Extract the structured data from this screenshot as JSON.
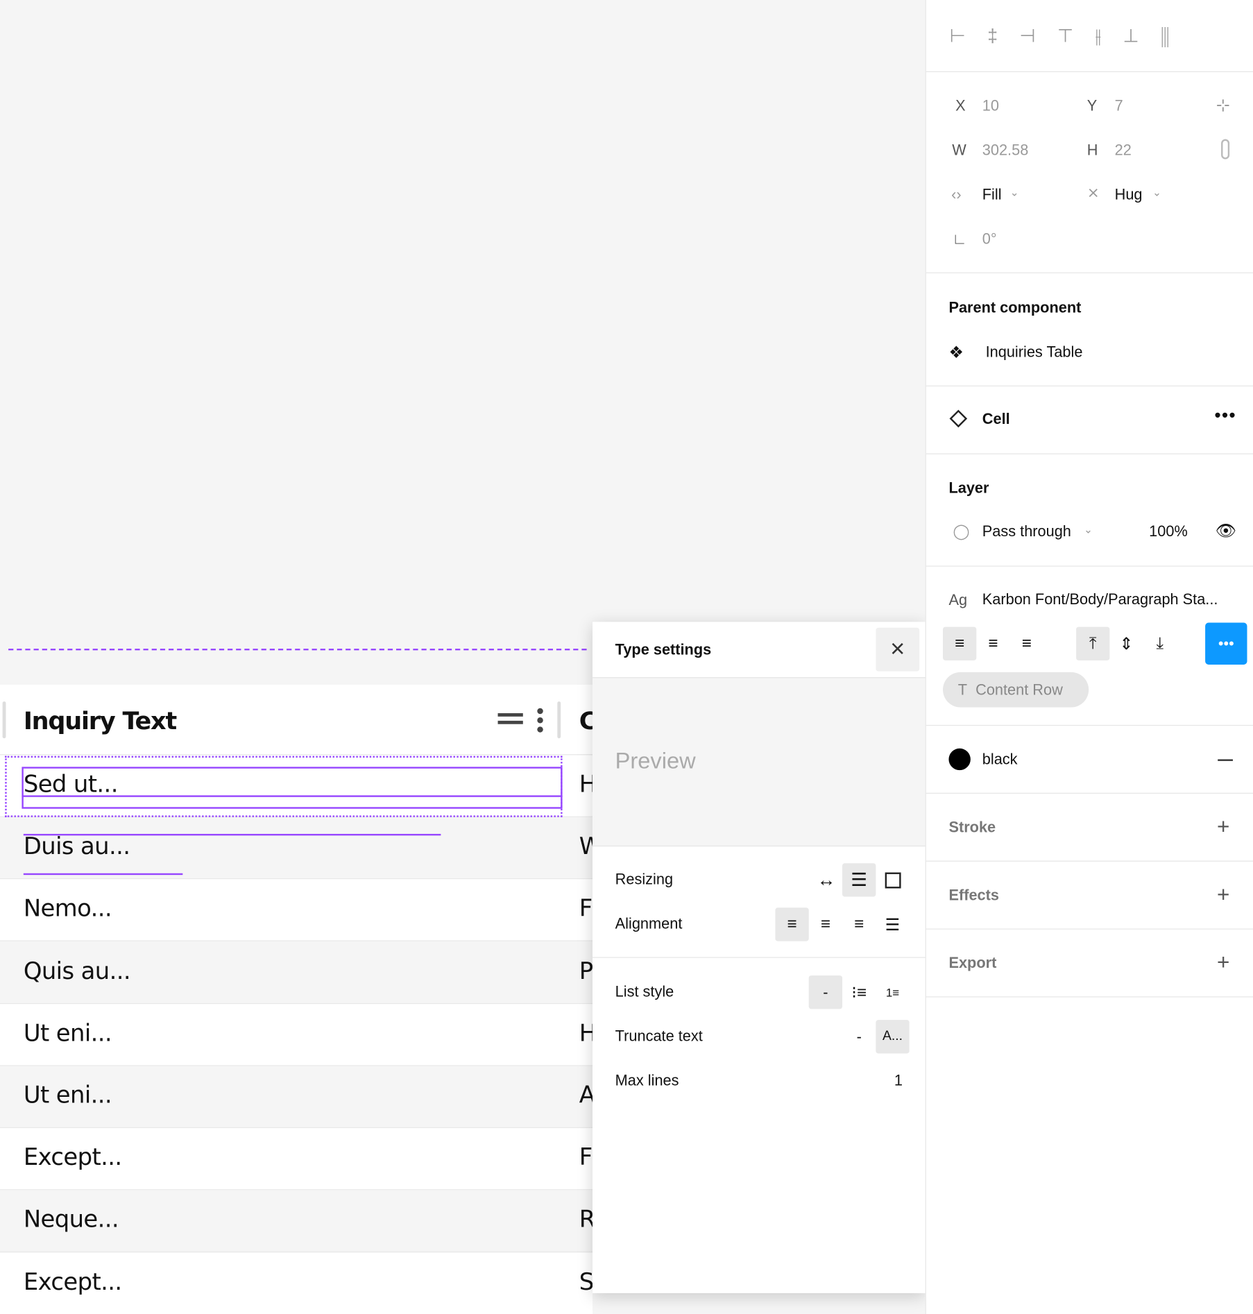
{
  "canvas": {
    "table": {
      "header": "Inquiry Text",
      "next_header_partial": "C",
      "rows": [
        {
          "c1": "Sed ut...",
          "c2": "H"
        },
        {
          "c1": "Duis au...",
          "c2": "W"
        },
        {
          "c1": "Nemo...",
          "c2": "F"
        },
        {
          "c1": "Quis au...",
          "c2": "P"
        },
        {
          "c1": "Ut eni...",
          "c2": "H"
        },
        {
          "c1": "Ut eni...",
          "c2": "A"
        },
        {
          "c1": "Except...",
          "c2": "F"
        },
        {
          "c1": "Neque...",
          "c2": "R"
        },
        {
          "c1": "Except...",
          "c2": "S"
        }
      ]
    },
    "selection_color": "#9747ff"
  },
  "type_settings": {
    "title": "Type settings",
    "preview": "Preview",
    "resizing": "Resizing",
    "alignment": "Alignment",
    "list_style": "List style",
    "list_none": "-",
    "truncate": "Truncate text",
    "truncate_none": "-",
    "truncate_on": "A...",
    "max_lines": "Max lines",
    "max_lines_value": "1"
  },
  "panel": {
    "x_label": "X",
    "x": "10",
    "y_label": "Y",
    "y": "7",
    "w_label": "W",
    "w": "302.58",
    "h_label": "H",
    "h": "22",
    "h_sizing": "Fill",
    "v_sizing": "Hug",
    "rotation": "0°",
    "parent_title": "Parent component",
    "parent_name": "Inquiries Table",
    "instance": "Cell",
    "layer_title": "Layer",
    "blend": "Pass through",
    "opacity": "100%",
    "text_style_icon": "Ag",
    "text_style": "Karbon Font/Body/Paragraph Sta...",
    "content_prop": "Content Row",
    "fill_name": "black",
    "fill_color": "#000000",
    "stroke": "Stroke",
    "effects": "Effects",
    "export": "Export",
    "accent": "#0d99ff"
  }
}
